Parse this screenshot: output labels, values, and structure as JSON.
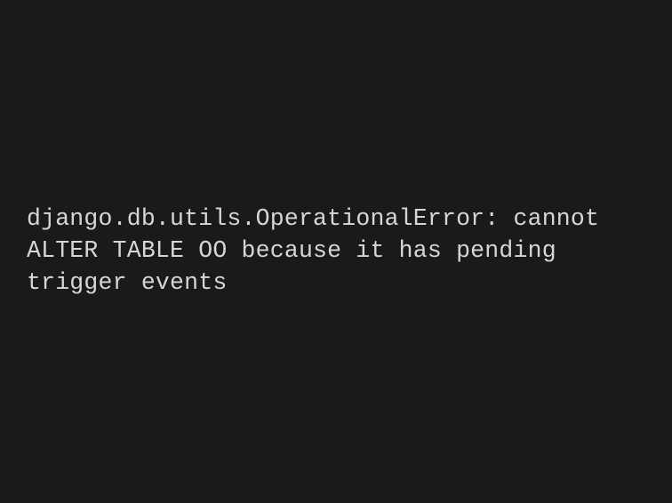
{
  "error": {
    "message": "django.db.utils.OperationalError: cannot ALTER TABLE OO because it has pending trigger events"
  }
}
